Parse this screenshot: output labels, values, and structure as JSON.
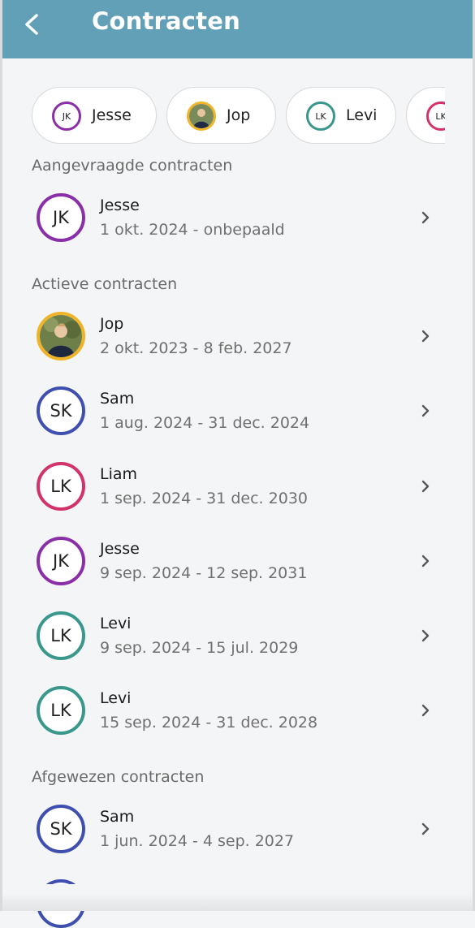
{
  "header": {
    "title": "Contracten"
  },
  "chips": [
    {
      "initials": "JK",
      "label": "Jesse",
      "color": "#8a2fa8"
    },
    {
      "initials": "",
      "label": "Jop",
      "color": "#f0b429",
      "photo": true
    },
    {
      "initials": "LK",
      "label": "Levi",
      "color": "#3a978b"
    },
    {
      "initials": "LK",
      "label": "",
      "color": "#d2336a"
    }
  ],
  "sections": {
    "requested": {
      "title": "Aangevraagde contracten",
      "items": [
        {
          "initials": "JK",
          "name": "Jesse",
          "period": "1 okt. 2024 - onbepaald",
          "color": "#8a2fa8"
        }
      ]
    },
    "active": {
      "title": "Actieve contracten",
      "items": [
        {
          "initials": "",
          "name": "Jop",
          "period": "2 okt. 2023 - 8 feb. 2027",
          "color": "#f0b429",
          "photo": true
        },
        {
          "initials": "SK",
          "name": "Sam",
          "period": "1 aug. 2024 - 31 dec. 2024",
          "color": "#3f4fb0"
        },
        {
          "initials": "LK",
          "name": "Liam",
          "period": "1 sep. 2024 - 31 dec. 2030",
          "color": "#d2336a"
        },
        {
          "initials": "JK",
          "name": "Jesse",
          "period": "9 sep. 2024 - 12 sep. 2031",
          "color": "#8a2fa8"
        },
        {
          "initials": "LK",
          "name": "Levi",
          "period": "9 sep. 2024 - 15 jul. 2029",
          "color": "#3a978b"
        },
        {
          "initials": "LK",
          "name": "Levi",
          "period": "15 sep. 2024 - 31 dec. 2028",
          "color": "#3a978b"
        }
      ]
    },
    "rejected": {
      "title": "Afgewezen contracten",
      "items": [
        {
          "initials": "SK",
          "name": "Sam",
          "period": "1 jun. 2024 - 4 sep. 2027",
          "color": "#3f4fb0"
        }
      ]
    }
  }
}
